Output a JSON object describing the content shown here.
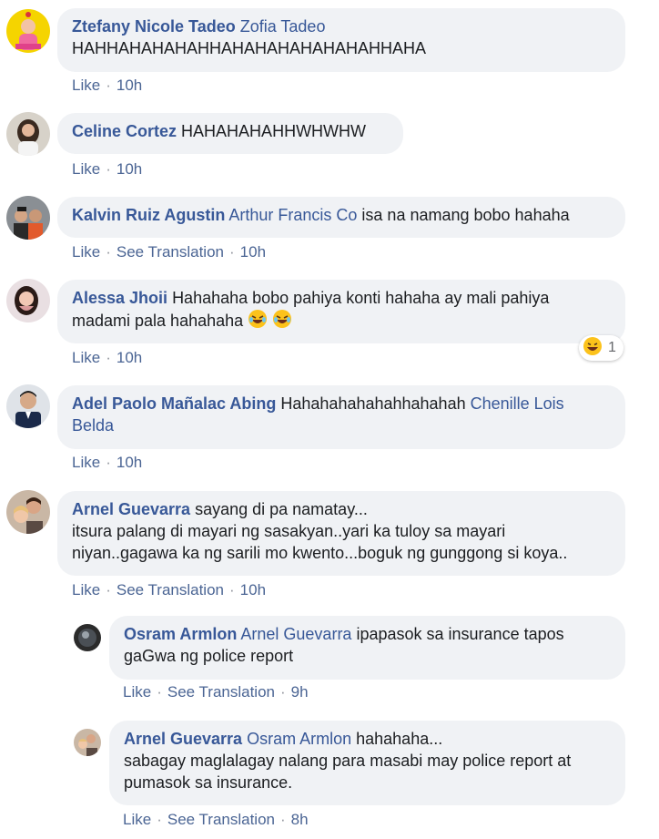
{
  "comments": [
    {
      "author": "Ztefany Nicole Tadeo",
      "tag": "Zofia Tadeo",
      "line1": "HAHHAHAHAHAHHAHAHAHAHAHAHAHHAHA",
      "like": "Like",
      "time": "10h"
    },
    {
      "author": "Celine Cortez",
      "text": "HAHAHAHAHHWHWHW",
      "like": "Like",
      "time": "10h"
    },
    {
      "author": "Kalvin Ruiz Agustin",
      "tag": "Arthur Francis Co",
      "text": "isa na namang bobo hahaha",
      "like": "Like",
      "translate": "See Translation",
      "time": "10h"
    },
    {
      "author": "Alessa Jhoii",
      "text": "Hahahaha bobo pahiya konti hahaha ay mali pahiya",
      "line2": "madami pala hahahaha",
      "like": "Like",
      "time": "10h",
      "reaction_count": "1"
    },
    {
      "author": "Adel Paolo Mañalac Abing",
      "text": "Hahahahahahahhahahah",
      "tag_a": "Chenille Lois",
      "tag_b": "Belda",
      "like": "Like",
      "time": "10h"
    },
    {
      "author": "Arnel Guevarra",
      "text": "sayang di pa namatay...",
      "line2": "itsura palang di mayari ng sasakyan..yari ka tuloy sa mayari",
      "line3": "niyan..gagawa ka ng sarili mo kwento...boguk ng gunggong si koya..",
      "like": "Like",
      "translate": "See Translation",
      "time": "10h"
    }
  ],
  "replies": [
    {
      "author": "Osram Armlon",
      "tag": "Arnel Guevarra",
      "text": "ipapasok sa insurance tapos",
      "line2": "gaGwa ng police report",
      "like": "Like",
      "translate": "See Translation",
      "time": "9h"
    },
    {
      "author": "Arnel Guevarra",
      "tag": "Osram Armlon",
      "text": "hahahaha...",
      "line2": "sabagay maglalagay nalang para masabi may police report at",
      "line3": "pumasok sa insurance.",
      "like": "Like",
      "translate": "See Translation",
      "time": "8h"
    }
  ],
  "colors": {
    "link": "#385898",
    "bubble": "#f0f2f5",
    "action": "#4b6594"
  },
  "icons": {
    "reaction": "laugh-emoji-icon",
    "inline_emoji": "rolling-laughing-emoji-icon"
  }
}
